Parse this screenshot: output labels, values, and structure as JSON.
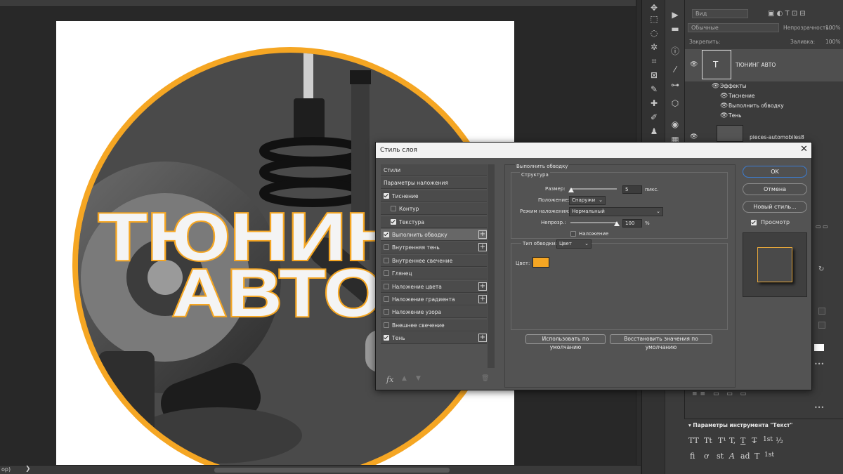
{
  "status": {
    "zoom": "ор)",
    "arrow": "❯"
  },
  "canvas": {
    "title_line1": "ТЮНИНГ",
    "title_line2": "АВТО",
    "accent": "#f5a623"
  },
  "layers_panel": {
    "kind_filter": "Вид",
    "blend_mode": "Обычные",
    "opacity_label": "Непрозрачность:",
    "opacity_value": "100%",
    "lock_label": "Закрепить:",
    "fill_label": "Заливка:",
    "fill_value": "100%",
    "text_layer_glyph": "T",
    "text_layer_name": "ТЮНИНГ АВТО",
    "effects_label": "Эффекты",
    "effects": [
      "Тиснение",
      "Выполнить обводку",
      "Тень"
    ],
    "image_layer_name": "pieces-automobiles8"
  },
  "text_params": {
    "title": "Параметры инструмента \"Текст\"",
    "row1": [
      "TT",
      "Tt",
      "T¹",
      "T,",
      "T",
      "T̶",
      "1st",
      "½"
    ],
    "row2": [
      "ﬁ",
      "ơ",
      "st",
      "A",
      "ad",
      "T",
      "1st",
      ""
    ]
  },
  "dialog": {
    "title": "Стиль слоя",
    "close": "✕",
    "list": [
      {
        "label": "Стили",
        "check": null,
        "sub": false,
        "plus": false,
        "active": false
      },
      {
        "label": "Параметры наложения",
        "check": null,
        "sub": false,
        "plus": false,
        "active": false
      },
      {
        "label": "Тиснение",
        "check": true,
        "sub": false,
        "plus": false,
        "active": false
      },
      {
        "label": "Контур",
        "check": false,
        "sub": true,
        "plus": false,
        "active": false
      },
      {
        "label": "Текстура",
        "check": true,
        "sub": true,
        "plus": false,
        "active": false
      },
      {
        "label": "Выполнить обводку",
        "check": true,
        "sub": false,
        "plus": true,
        "active": true
      },
      {
        "label": "Внутренняя тень",
        "check": false,
        "sub": false,
        "plus": true,
        "active": false
      },
      {
        "label": "Внутреннее свечение",
        "check": false,
        "sub": false,
        "plus": false,
        "active": false
      },
      {
        "label": "Глянец",
        "check": false,
        "sub": false,
        "plus": false,
        "active": false
      },
      {
        "label": "Наложение цвета",
        "check": false,
        "sub": false,
        "plus": true,
        "active": false
      },
      {
        "label": "Наложение градиента",
        "check": false,
        "sub": false,
        "plus": true,
        "active": false
      },
      {
        "label": "Наложение узора",
        "check": false,
        "sub": false,
        "plus": false,
        "active": false
      },
      {
        "label": "Внешнее свечение",
        "check": false,
        "sub": false,
        "plus": false,
        "active": false
      },
      {
        "label": "Тень",
        "check": true,
        "sub": false,
        "plus": true,
        "active": false
      }
    ],
    "footer": {
      "fx": "fx",
      "up": "▲",
      "down": "▼",
      "trash": "🗑"
    },
    "panel_title": "Выполнить обводку",
    "structure_title": "Структура",
    "size_label": "Размер:",
    "size_value": "5",
    "size_unit": "пикс.",
    "position_label": "Положение:",
    "position_value": "Снаружи",
    "blend_label": "Режим наложения:",
    "blend_value": "Нормальный",
    "opacity_label": "Непрозр.:",
    "opacity_value": "100",
    "opacity_unit": "%",
    "overprint_label": "Наложение",
    "fill_type_label": "Тип обводки:",
    "fill_type_value": "Цвет",
    "color_label": "Цвет:",
    "stroke_color": "#f5a623",
    "default_btn": "Использовать по умолчанию",
    "reset_btn": "Восстановить значения по умолчанию",
    "ok": "OK",
    "cancel": "Отмена",
    "new_style": "Новый стиль...",
    "preview_label": "Просмотр"
  }
}
